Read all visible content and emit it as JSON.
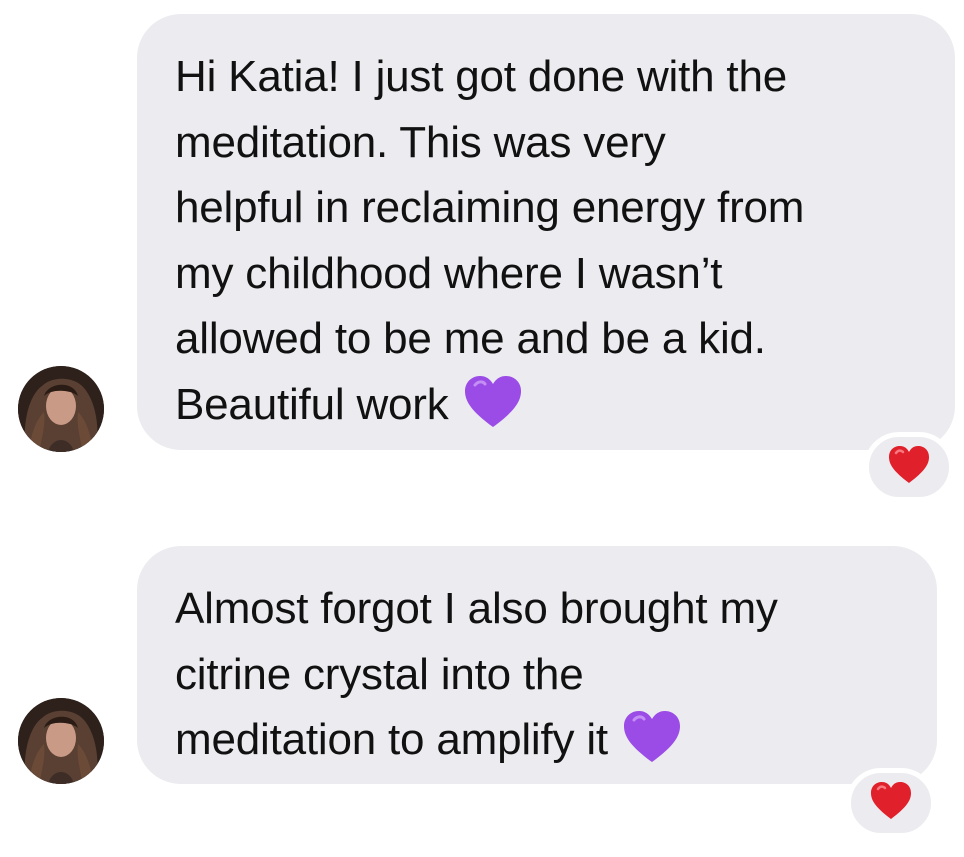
{
  "messages": [
    {
      "text": "Hi Katia! I just got done with the\nmeditation. This was very\nhelpful in reclaiming energy from\nmy childhood where I wasn’t\nallowed to be me and be a kid.\nBeautiful work",
      "trailing_emoji": "purple-heart",
      "reaction": "red-heart"
    },
    {
      "text": "Almost forgot I also brought my\ncitrine crystal into the\nmeditation to amplify it",
      "trailing_emoji": "purple-heart",
      "reaction": "red-heart"
    }
  ],
  "colors": {
    "bubble": "#ebebf0",
    "text": "#111111",
    "purple_heart": "#9b4be6",
    "red_heart": "#e0202a"
  }
}
